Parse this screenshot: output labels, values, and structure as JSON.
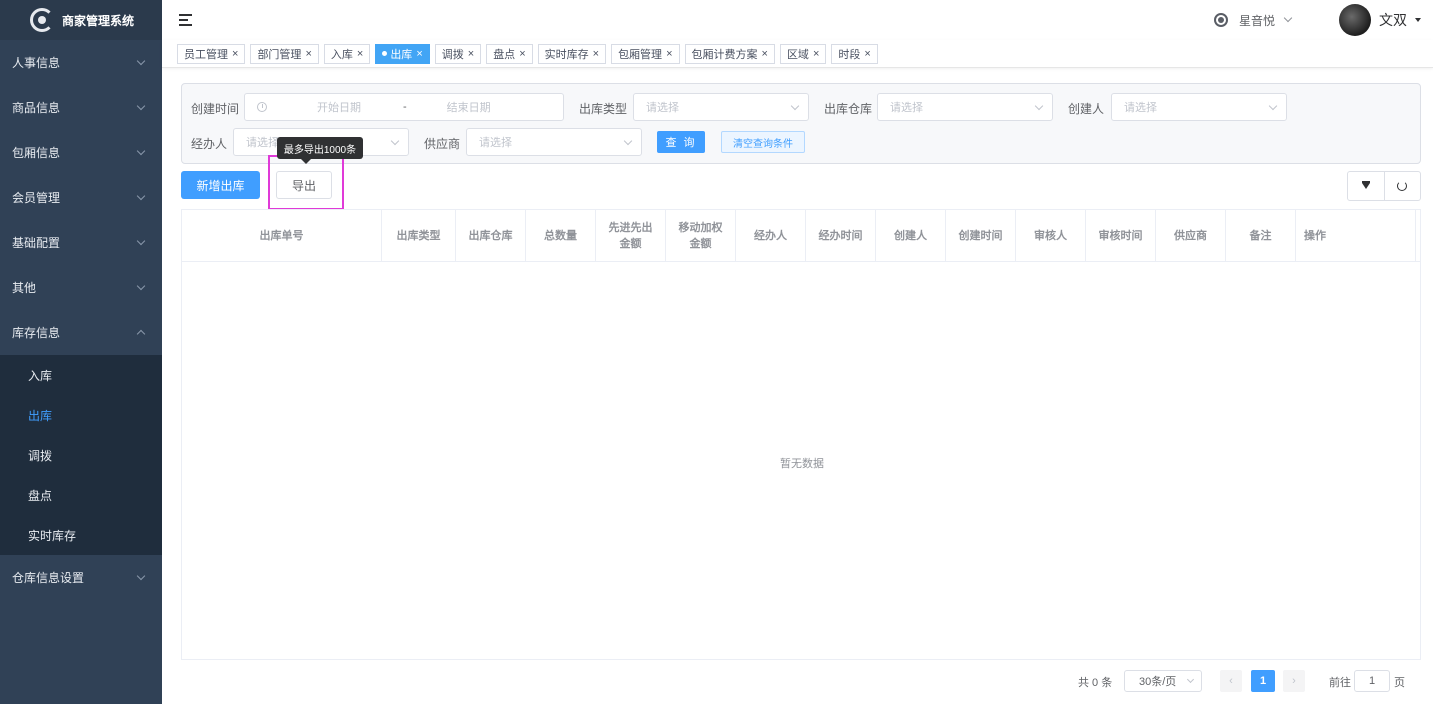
{
  "app": {
    "title": "商家管理系统",
    "logo_icon": "app-logo-icon"
  },
  "sidebar": {
    "items": [
      {
        "label": "人事信息"
      },
      {
        "label": "商品信息"
      },
      {
        "label": "包厢信息"
      },
      {
        "label": "会员管理"
      },
      {
        "label": "基础配置"
      },
      {
        "label": "其他"
      },
      {
        "label": "库存信息"
      }
    ],
    "submenu": [
      {
        "label": "入库"
      },
      {
        "label": "出库"
      },
      {
        "label": "调拨"
      },
      {
        "label": "盘点"
      },
      {
        "label": "实时库存"
      }
    ],
    "last": {
      "label": "仓库信息设置"
    },
    "active_color": "#409eff",
    "background": "#304156"
  },
  "header": {
    "store_name": "星音悦",
    "user_name": "文双"
  },
  "tags": [
    {
      "label": "员工管理"
    },
    {
      "label": "部门管理"
    },
    {
      "label": "入库"
    },
    {
      "label": "出库"
    },
    {
      "label": "调拨"
    },
    {
      "label": "盘点"
    },
    {
      "label": "实时库存"
    },
    {
      "label": "包厢管理"
    },
    {
      "label": "包厢计费方案"
    },
    {
      "label": "区域"
    },
    {
      "label": "时段"
    }
  ],
  "filters": {
    "created_time_label": "创建时间",
    "start_placeholder": "开始日期",
    "range_sep": "-",
    "end_placeholder": "结束日期",
    "out_type_label": "出库类型",
    "out_type_placeholder": "请选择",
    "warehouse_label": "出库仓库",
    "warehouse_placeholder": "请选择",
    "creator_label": "创建人",
    "creator_placeholder": "请选择",
    "handler_label": "经办人",
    "handler_placeholder": "请选择",
    "supplier_label": "供应商",
    "supplier_placeholder": "请选择",
    "query_button": "查 询",
    "clear_button": "清空查询条件"
  },
  "toolbar": {
    "add_button": "新增出库",
    "export_button": "导出",
    "export_tooltip": "最多导出1000条"
  },
  "table": {
    "columns": [
      "出库单号",
      "出库类型",
      "出库仓库",
      "总数量",
      "先进先出\n金额",
      "移动加权\n金额",
      "经办人",
      "经办时间",
      "创建人",
      "创建时间",
      "审核人",
      "审核时间",
      "供应商",
      "备注",
      "操作"
    ],
    "empty_text": "暂无数据"
  },
  "pagination": {
    "total_text": "共 0 条",
    "page_size": "30条/页",
    "current_page": "1",
    "goto_label": "前往",
    "goto_value": "1",
    "page_suffix": "页"
  }
}
